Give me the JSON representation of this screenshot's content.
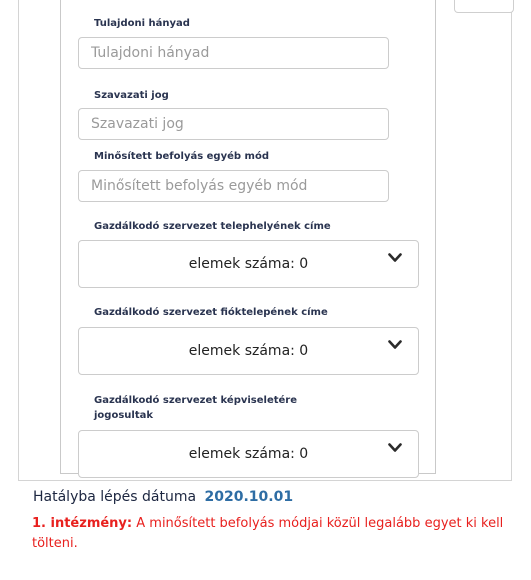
{
  "form": {
    "ownership_share": {
      "label": "Tulajdoni hányad",
      "placeholder": "Tulajdoni hányad",
      "value": ""
    },
    "voting_right": {
      "label": "Szavazati jog",
      "placeholder": "Szavazati jog",
      "value": ""
    },
    "qualified_influence_other": {
      "label": "Minősített befolyás egyéb mód",
      "placeholder": "Minősített befolyás egyéb mód",
      "value": ""
    },
    "site_address": {
      "label": "Gazdálkodó szervezet telephelyének címe",
      "value": "elemek száma: 0"
    },
    "branch_address": {
      "label": "Gazdálkodó szervezet fióktelepének címe",
      "value": "elemek száma: 0"
    },
    "representative_authorized": {
      "label_line1": "Gazdálkodó szervezet képviseletére",
      "label_line2": "jogosultak",
      "value": "elemek száma: 0"
    }
  },
  "effective_date": {
    "label": "Hatályba lépés dátuma",
    "value": "2020.10.01"
  },
  "error": {
    "prefix": "1. intézmény:",
    "message": "A minősített befolyás módjai közül legalább egyet ki kell tölteni."
  },
  "colors": {
    "error": "#e8201e",
    "date_value": "#2e6da4",
    "label": "#2a3450"
  },
  "icons": {
    "dropdown": "chevron-down-icon"
  }
}
